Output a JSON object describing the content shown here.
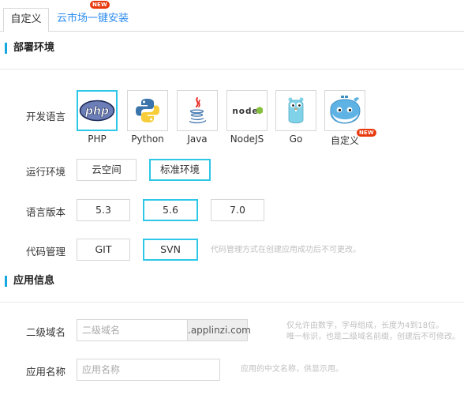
{
  "tabs": [
    {
      "label": "自定义",
      "active": true
    },
    {
      "label": "云市场一键安装",
      "badge": "NEW"
    }
  ],
  "sections": {
    "deploy": "部署环境",
    "app_info": "应用信息"
  },
  "deploy": {
    "language": {
      "label": "开发语言",
      "options": [
        {
          "name": "PHP",
          "icon": "php-logo-icon",
          "selected": true
        },
        {
          "name": "Python",
          "icon": "python-logo-icon"
        },
        {
          "name": "Java",
          "icon": "java-logo-icon"
        },
        {
          "name": "NodeJS",
          "icon": "nodejs-logo-icon",
          "logo_text": "node"
        },
        {
          "name": "Go",
          "icon": "go-gopher-icon"
        },
        {
          "name": "自定义",
          "icon": "docker-whale-icon",
          "badge": "NEW"
        }
      ]
    },
    "runtime": {
      "label": "运行环境",
      "options": [
        {
          "name": "云空间"
        },
        {
          "name": "标准环境",
          "selected": true
        }
      ]
    },
    "version": {
      "label": "语言版本",
      "options": [
        {
          "name": "5.3"
        },
        {
          "name": "5.6",
          "selected": true
        },
        {
          "name": "7.0"
        }
      ]
    },
    "vcs": {
      "label": "代码管理",
      "options": [
        {
          "name": "GIT"
        },
        {
          "name": "SVN",
          "selected": true
        }
      ],
      "hint": "代码管理方式在创建应用成功后不可更改。"
    }
  },
  "app_info": {
    "domain": {
      "label": "二级域名",
      "placeholder": "二级域名",
      "suffix": ".applinzi.com",
      "hint_line1": "仅允许由数字，字母组成，长度为4到18位。",
      "hint_line2": "唯一标识，也是二级域名前缀，创建后不可修改。"
    },
    "name": {
      "label": "应用名称",
      "placeholder": "应用名称",
      "hint": "应用的中文名称，供显示用。"
    }
  },
  "colors": {
    "accent": "#2ec7e8",
    "section_marker": "#14a8de",
    "tab_link": "#2d8cf0",
    "badge": "#e8380d"
  }
}
